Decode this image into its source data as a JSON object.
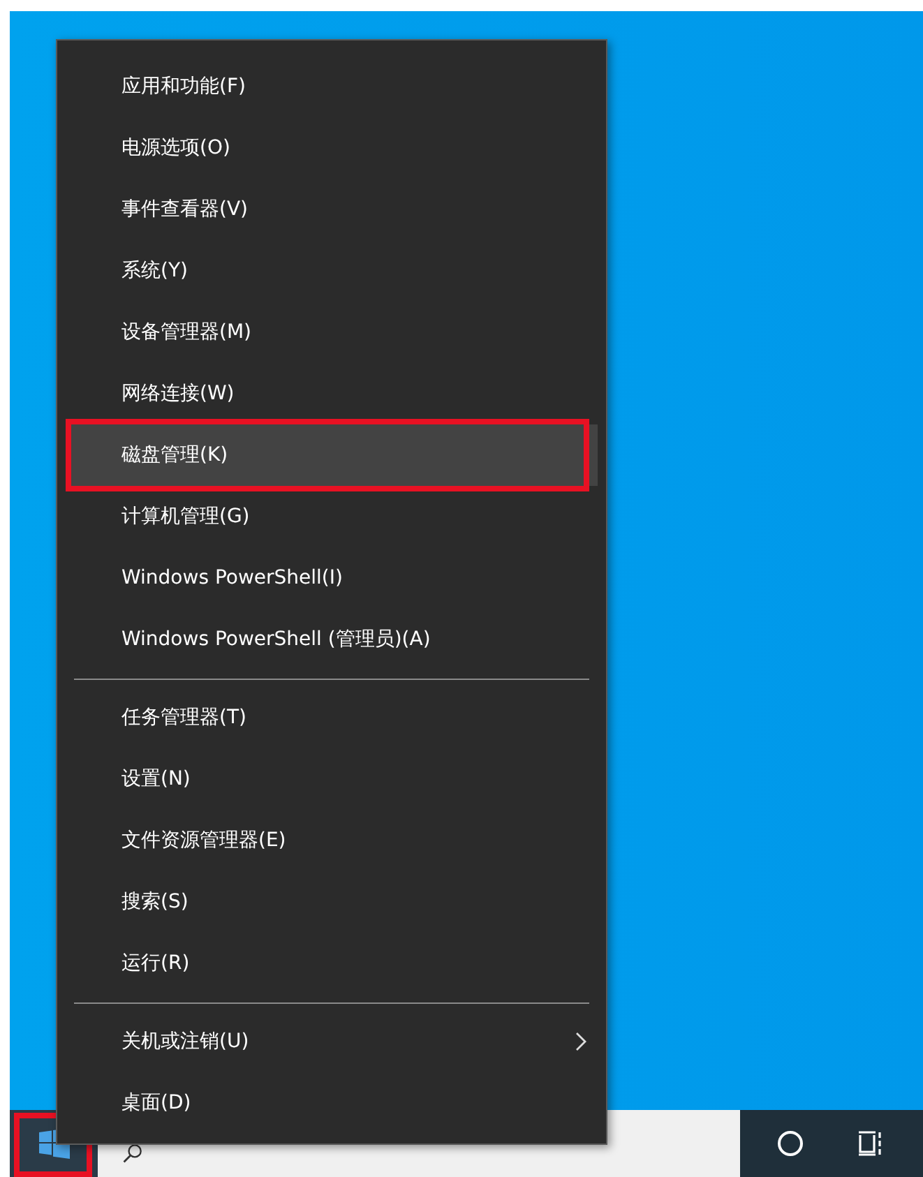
{
  "context_menu": {
    "items": [
      {
        "kind": "item",
        "label": "应用和功能(F)",
        "selected": false,
        "annotated": false,
        "has_submenu": false
      },
      {
        "kind": "item",
        "label": "电源选项(O)",
        "selected": false,
        "annotated": false,
        "has_submenu": false
      },
      {
        "kind": "item",
        "label": "事件查看器(V)",
        "selected": false,
        "annotated": false,
        "has_submenu": false
      },
      {
        "kind": "item",
        "label": "系统(Y)",
        "selected": false,
        "annotated": false,
        "has_submenu": false
      },
      {
        "kind": "item",
        "label": "设备管理器(M)",
        "selected": false,
        "annotated": false,
        "has_submenu": false
      },
      {
        "kind": "item",
        "label": "网络连接(W)",
        "selected": false,
        "annotated": false,
        "has_submenu": false
      },
      {
        "kind": "item",
        "label": "磁盘管理(K)",
        "selected": true,
        "annotated": true,
        "has_submenu": false
      },
      {
        "kind": "item",
        "label": "计算机管理(G)",
        "selected": false,
        "annotated": false,
        "has_submenu": false
      },
      {
        "kind": "item",
        "label": "Windows PowerShell(I)",
        "selected": false,
        "annotated": false,
        "has_submenu": false
      },
      {
        "kind": "item",
        "label": "Windows PowerShell (管理员)(A)",
        "selected": false,
        "annotated": false,
        "has_submenu": false
      },
      {
        "kind": "separator"
      },
      {
        "kind": "item",
        "label": "任务管理器(T)",
        "selected": false,
        "annotated": false,
        "has_submenu": false
      },
      {
        "kind": "item",
        "label": "设置(N)",
        "selected": false,
        "annotated": false,
        "has_submenu": false
      },
      {
        "kind": "item",
        "label": "文件资源管理器(E)",
        "selected": false,
        "annotated": false,
        "has_submenu": false
      },
      {
        "kind": "item",
        "label": "搜索(S)",
        "selected": false,
        "annotated": false,
        "has_submenu": false
      },
      {
        "kind": "item",
        "label": "运行(R)",
        "selected": false,
        "annotated": false,
        "has_submenu": false
      },
      {
        "kind": "separator"
      },
      {
        "kind": "item",
        "label": "关机或注销(U)",
        "selected": false,
        "annotated": false,
        "has_submenu": true
      },
      {
        "kind": "item",
        "label": "桌面(D)",
        "selected": false,
        "annotated": false,
        "has_submenu": false
      }
    ]
  },
  "taskbar": {
    "start_button": {
      "annotated": true
    }
  }
}
